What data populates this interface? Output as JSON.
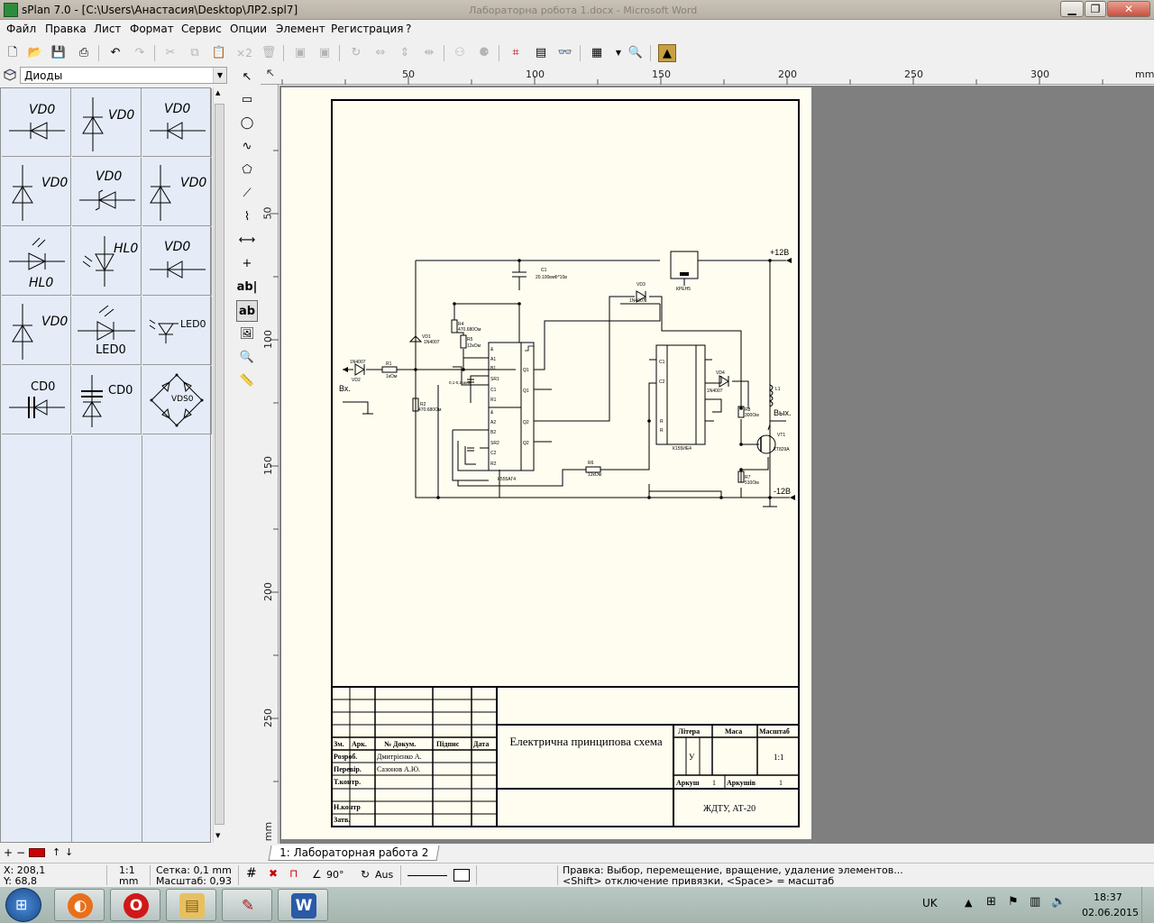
{
  "window": {
    "title": "sPlan 7.0 - [C:\\Users\\Анастасия\\Desktop\\ЛР2.spl7]",
    "background_title": "Лабораторна робота 1.docx - Microsoft Word"
  },
  "menu": [
    "Файл",
    "Правка",
    "Лист",
    "Формат",
    "Сервис",
    "Опции",
    "Элемент",
    "Регистрация",
    "?"
  ],
  "toolbar": {
    "copies_label": "×2"
  },
  "library": {
    "selected": "Диоды",
    "labels": {
      "vd": "VD0",
      "hl": "HL0",
      "led": "LED0",
      "cd": "CD0",
      "vds": "VDS0"
    }
  },
  "ruler": {
    "h_ticks": [
      "50",
      "100",
      "150",
      "200",
      "250",
      "300"
    ],
    "h_unit": "mm",
    "v_ticks": [
      "50",
      "100",
      "150",
      "200",
      "250"
    ],
    "v_unit": "mm"
  },
  "schematic": {
    "supply_pos": "+12В",
    "supply_neg": "-12В",
    "input": "Вх.",
    "output": "Вых.",
    "chip1": "К555АГ4",
    "chip2": "К155ИЕ4",
    "stab": "КРЕН5",
    "c1": "C1",
    "c1_val": "20.100мкФ*10в",
    "vd1": "VD1",
    "vd1_type": "1N4007",
    "vd2": "VD2",
    "vd2_type": "1N4007",
    "vd3": "VD3",
    "vd3_type": "1N4007",
    "vd4": "VD4",
    "vd4_type": "1N4007",
    "r1": "R1",
    "r1_val": "1кОм",
    "r2": "R2",
    "r2_val": "470.680Ом",
    "r4": "R4",
    "r4_val": "470.680Ом",
    "r5": "R5",
    "r5_val": "12кОм",
    "r6": "R6",
    "r6_val": "12кОм",
    "r7": "R7",
    "r7_val": "510Ом",
    "r8": "R8",
    "r8_val": "300Ом",
    "vt1": "VT1",
    "vt1_type": "КТ829А",
    "l1": "L1",
    "c_small": "0,1-0,2 мкФ",
    "pins_left": [
      "&",
      "A1",
      "B1",
      "SR1",
      "C1",
      "R1",
      "&",
      "A2",
      "B2",
      "SR2",
      "C2",
      "R2"
    ],
    "pins_right": [
      "Q1",
      "Q1",
      "Q2",
      "Q2"
    ],
    "chip2_pins": [
      "C1",
      "C2",
      "R",
      "R"
    ]
  },
  "titleblock": {
    "head": [
      "Зм.",
      "Арк.",
      "№ Докум.",
      "Підпис",
      "Дата"
    ],
    "rows": [
      {
        "role": "Розроб.",
        "name": "Дмитрієнко А."
      },
      {
        "role": "Перевір.",
        "name": "Сазонов А.Ю."
      },
      {
        "role": "Т.контр.",
        "name": ""
      },
      {
        "role": "",
        "name": ""
      },
      {
        "role": "Н.контр",
        "name": ""
      },
      {
        "role": "Затв.",
        "name": ""
      }
    ],
    "title": "Електрична принципова схема",
    "litera_h": "Літера",
    "mass_h": "Маса",
    "scale_h": "Масштаб",
    "litera": "У",
    "scale": "1:1",
    "sheet_l": "Аркуш",
    "sheet_v": "1",
    "sheets_l": "Аркушів",
    "sheets_v": "1",
    "org": "ЖДТУ, АТ-20"
  },
  "tabs": [
    "1: Лабораторная работа 2"
  ],
  "status": {
    "x": "X: 208,1",
    "y": "Y: 68,8",
    "scale": "1:1",
    "unit": "mm",
    "grid": "Сетка: 0,1 mm",
    "zoom": "Масштаб:  0,93",
    "angle": "90°",
    "aus": "Aus",
    "hint1": "Правка: Выбор, перемещение, вращение, удаление элементов...",
    "hint2": "<Shift> отключение привязки, <Space> = масштаб"
  },
  "taskbar": {
    "lang": "UK",
    "time": "18:37",
    "date": "02.06.2015"
  }
}
